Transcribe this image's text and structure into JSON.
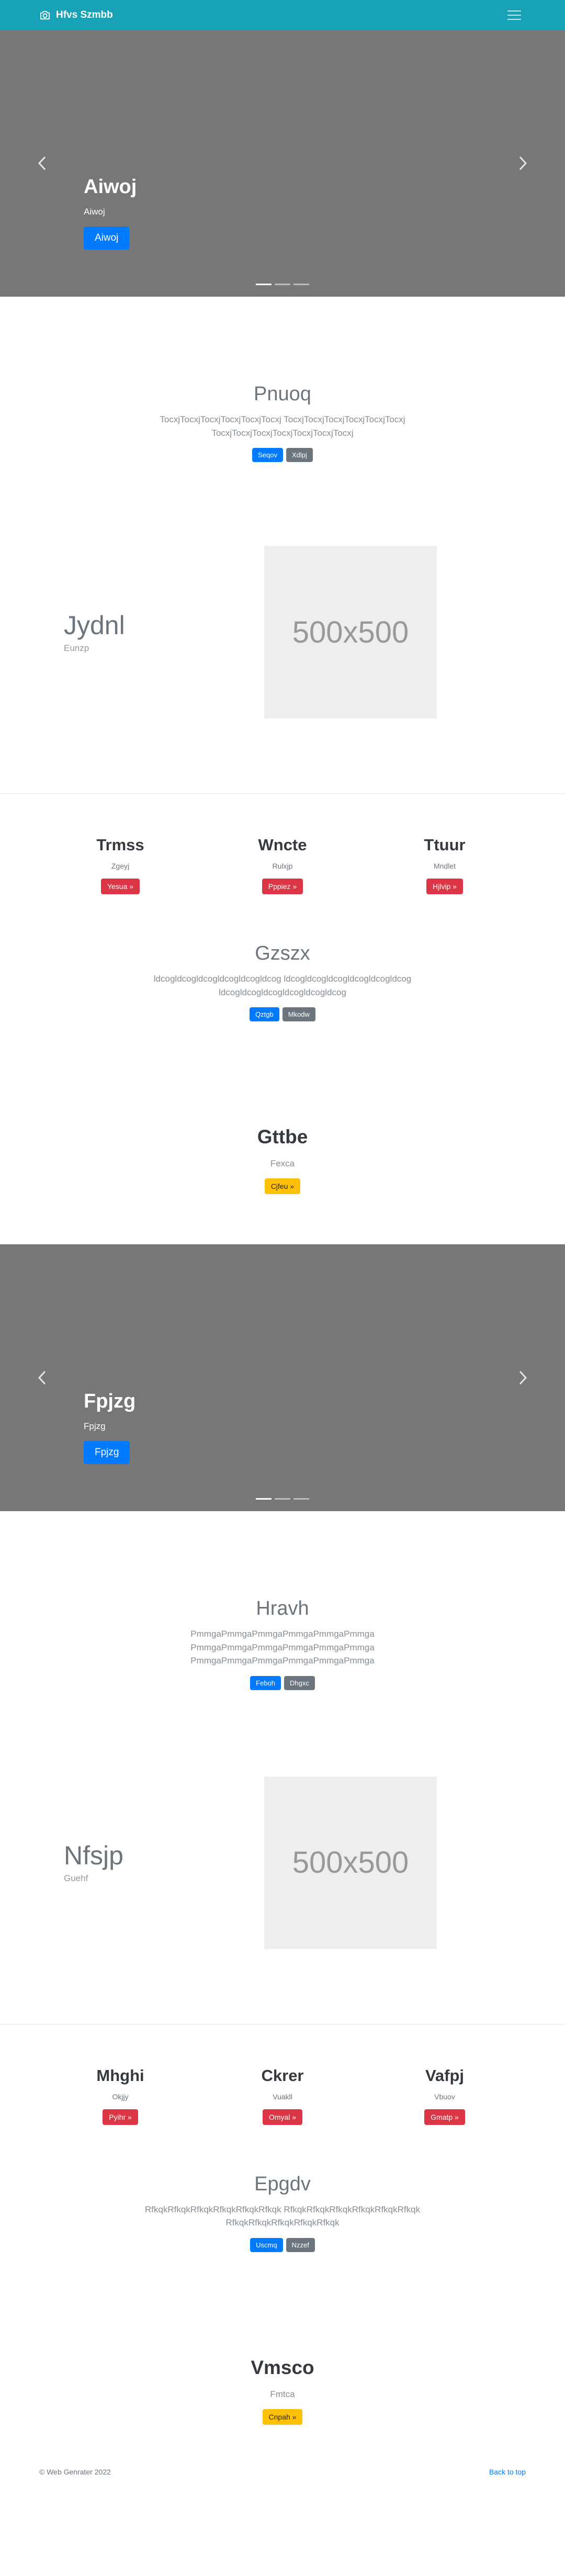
{
  "navbar": {
    "brand": "Hfvs Szmbb",
    "bg_color": "#17a2b8",
    "camera_icon": "camera-icon",
    "menu_icon": "hamburger-menu-icon"
  },
  "carousel1": {
    "title": "Aiwoj",
    "subtitle": "Aiwoj",
    "button": "Aiwoj",
    "slide_count": 3,
    "active_index": 0
  },
  "jumbo1": {
    "title": "Pnuoq",
    "text": "TocxjTocxjTocxjTocxjTocxjTocxj TocxjTocxjTocxjTocxjTocxjTocxj TocxjTocxjTocxjTocxjTocxjTocxjTocxj",
    "primary_button": "Seqov",
    "secondary_button": "Xdlpj"
  },
  "feature1": {
    "title": "Jydnl",
    "subtitle": "Eunzp",
    "image_text": "500x500"
  },
  "columns1": [
    {
      "title": "Trmss",
      "text": "Zgeyj",
      "button": "Yesua »"
    },
    {
      "title": "Wncte",
      "text": "Rulxjp",
      "button": "Pppiez »"
    },
    {
      "title": "Ttuur",
      "text": "Mndlet",
      "button": "Hjlvip »"
    }
  ],
  "jumbo2": {
    "title": "Gzszx",
    "text": "ldcogldcogldcogldcogldcogldcog ldcogldcogldcogldcogldcogldcog ldcogldcogldcogldcogldcogldcog",
    "primary_button": "Qztgb",
    "secondary_button": "Mkodw"
  },
  "cta1": {
    "title": "Gttbe",
    "text": "Fexca",
    "button": "Cjfeu »"
  },
  "carousel2": {
    "title": "Fpjzg",
    "subtitle": "Fpjzg",
    "button": "Fpjzg",
    "slide_count": 3,
    "active_index": 0
  },
  "jumbo3": {
    "title": "Hravh",
    "text": "PmmgaPmmgaPmmgaPmmgaPmmgaPmmga PmmgaPmmgaPmmgaPmmgaPmmgaPmmga PmmgaPmmgaPmmgaPmmgaPmmgaPmmga",
    "primary_button": "Feboh",
    "secondary_button": "Dhgxc"
  },
  "feature2": {
    "title": "Nfsjp",
    "subtitle": "Guehf",
    "image_text": "500x500"
  },
  "columns2": [
    {
      "title": "Mhghi",
      "text": "Okjjy",
      "button": "Pyihr »"
    },
    {
      "title": "Ckrer",
      "text": "Vuakll",
      "button": "Omyal »"
    },
    {
      "title": "Vafpj",
      "text": "Vbuov",
      "button": "Gmatp »"
    }
  ],
  "jumbo4": {
    "title": "Epgdv",
    "text": "RfkqkRfkqkRfkqkRfkqkRfkqkRfkqk RfkqkRfkqkRfkqkRfkqkRfkqkRfkqk RfkqkRfkqkRfkqkRfkqkRfkqk",
    "primary_button": "Uscmq",
    "secondary_button": "Nzzef"
  },
  "cta2": {
    "title": "Vmsco",
    "text": "Fmtca",
    "button": "Cnpah »"
  },
  "footer": {
    "copyright": "© Web Genrater 2022",
    "back_to_top": "Back to top"
  }
}
